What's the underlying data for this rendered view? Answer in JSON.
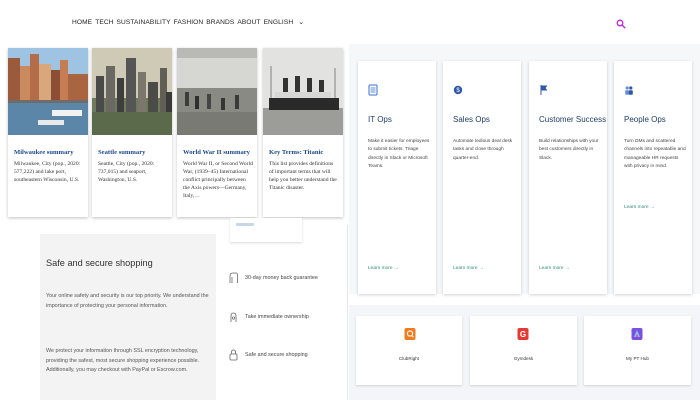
{
  "nav": {
    "items": [
      "HOME",
      "TECH",
      "SUSTAINABILITY",
      "FASHION",
      "BRANDS",
      "ABOUT",
      "ENGLISH"
    ],
    "dropdown_icon": "chevron-down-icon",
    "search_icon": "search-icon",
    "accent_color": "#c026d3"
  },
  "articles": [
    {
      "title": "Milwaukee summary",
      "description": "Milwaukee, City (pop., 2020: 577,222) and lake port, southeastern Wisconsin, U.S.",
      "image": "city waterfront photo"
    },
    {
      "title": "Seattle summary",
      "description": "Seattle, City (pop., 2020: 737,015) and seaport, Washington, U.S.",
      "image": "city skyline photo"
    },
    {
      "title": "World War II summary",
      "description": "World War II, or Second World War, (1939–45) International conflict principally between the Axis powers—Germany, Italy,…",
      "image": "historical troops photo"
    },
    {
      "title": "Key Terms: Titanic",
      "description": "This list provides definitions of important terms that will help you better understand the Titanic disaster.",
      "image": "titanic ship photo"
    }
  ],
  "ops": [
    {
      "icon": "server-icon",
      "title": "IT Ops",
      "description": "Make it easier for employees to submit tickets. Triage directly in Slack or Microsoft Teams.",
      "link": "Learn more →"
    },
    {
      "icon": "dollar-coin-icon",
      "title": "Sales Ops",
      "description": "Automate tedious deal desk tasks and close through quarter-end.",
      "link": "Learn more →"
    },
    {
      "icon": "flag-icon",
      "title": "Customer Success",
      "description": "Build relationships with your best customers directly in Slack.",
      "link": "Learn more →"
    },
    {
      "icon": "people-icon",
      "title": "People Ops",
      "description": "Turn DMs and scattered channels into repeatable and manageable HR requests with privacy in mind.",
      "link": "Learn more →"
    }
  ],
  "apps": [
    {
      "icon": "clubright-icon",
      "name": "ClubRight",
      "color": "#f07b1d"
    },
    {
      "icon": "gymdesk-icon",
      "name": "Gymdesk",
      "color": "#e53935"
    },
    {
      "icon": "mypthub-icon",
      "name": "My PT Hub",
      "color": "#7b4fe0"
    }
  ],
  "safe_shopping": {
    "title": "Safe and secure shopping",
    "paragraph1": "Your online safety and security is our top priority. We understand the importance of protecting your personal information.",
    "paragraph2": "We protect your information through SSL encryption technology, providing the safest, most secure shopping experience possible. Additionally, you may checkout with PayPal or Escrow.com."
  },
  "trust_badges": [
    {
      "icon": "money-back-icon",
      "label": "30-day money back guarantee"
    },
    {
      "icon": "ownership-icon",
      "label": "Take immediate ownership"
    },
    {
      "icon": "lock-icon",
      "label": "Safe and secure shopping"
    }
  ]
}
